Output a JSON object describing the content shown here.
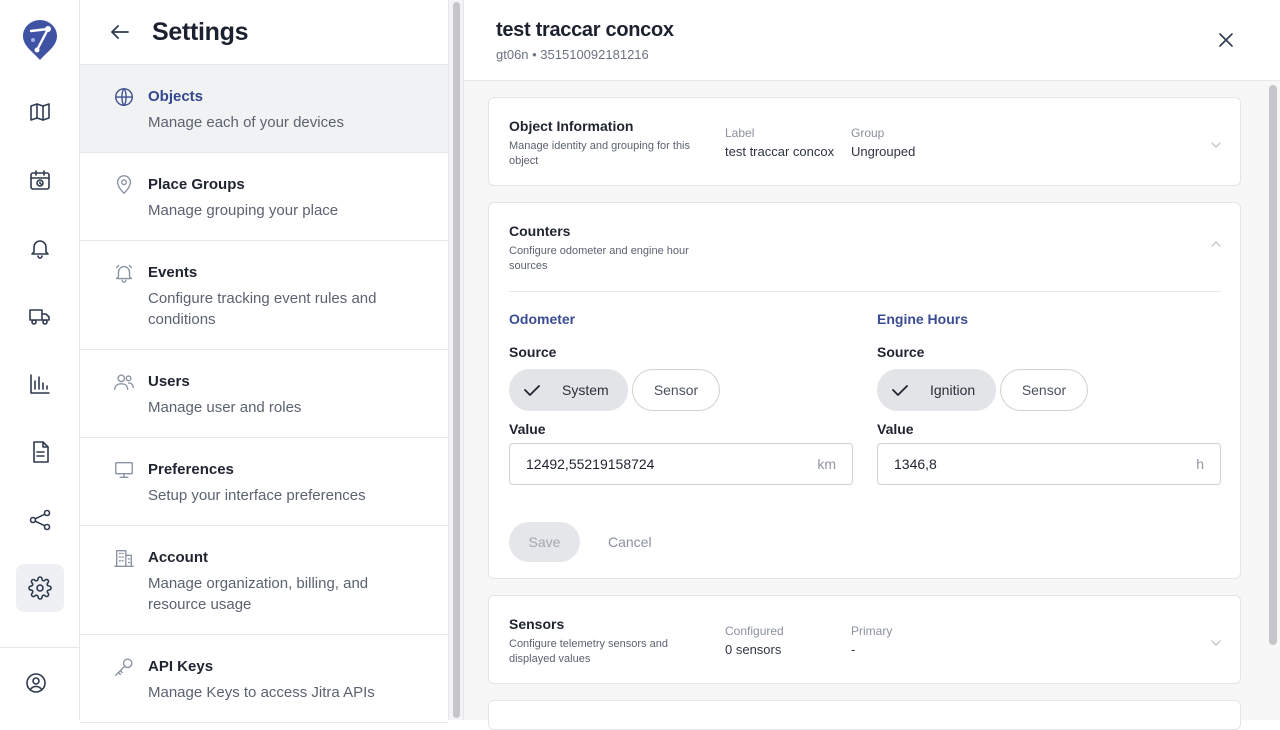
{
  "rail": {
    "items": [
      "map-icon",
      "calendar-icon",
      "bell-icon",
      "truck-icon",
      "chart-icon",
      "document-icon",
      "share-icon",
      "settings-icon"
    ],
    "active": "settings-icon",
    "bottom": "user-circle-icon"
  },
  "settings": {
    "title": "Settings",
    "items": [
      {
        "title": "Objects",
        "desc": "Manage each of your devices",
        "icon": "globe-icon",
        "active": true
      },
      {
        "title": "Place Groups",
        "desc": "Manage grouping your place",
        "icon": "pin-icon"
      },
      {
        "title": "Events",
        "desc": "Configure tracking event rules and conditions",
        "icon": "bell-icon"
      },
      {
        "title": "Users",
        "desc": "Manage user and roles",
        "icon": "users-icon"
      },
      {
        "title": "Preferences",
        "desc": "Setup your interface preferences",
        "icon": "monitor-icon"
      },
      {
        "title": "Account",
        "desc": "Manage organization, billing, and resource usage",
        "icon": "building-icon"
      },
      {
        "title": "API Keys",
        "desc": "Manage Keys to access Jitra APIs",
        "icon": "key-icon"
      }
    ]
  },
  "detail": {
    "title": "test traccar concox",
    "subtitle": "gt06n • 351510092181216",
    "object_info": {
      "title": "Object Information",
      "desc": "Manage identity and grouping for this object",
      "label_label": "Label",
      "label_value": "test traccar concox",
      "group_label": "Group",
      "group_value": "Ungrouped"
    },
    "counters": {
      "title": "Counters",
      "desc": "Configure odometer and engine hour sources",
      "odometer": {
        "title": "Odometer",
        "source_label": "Source",
        "opt_selected": "System",
        "opt_other": "Sensor",
        "value_label": "Value",
        "value": "12492,55219158724",
        "unit": "km"
      },
      "engine": {
        "title": "Engine Hours",
        "source_label": "Source",
        "opt_selected": "Ignition",
        "opt_other": "Sensor",
        "value_label": "Value",
        "value": "1346,8",
        "unit": "h"
      },
      "save": "Save",
      "cancel": "Cancel"
    },
    "sensors": {
      "title": "Sensors",
      "desc": "Configure telemetry sensors and displayed values",
      "configured_label": "Configured",
      "configured_value": "0 sensors",
      "primary_label": "Primary",
      "primary_value": "-"
    }
  }
}
